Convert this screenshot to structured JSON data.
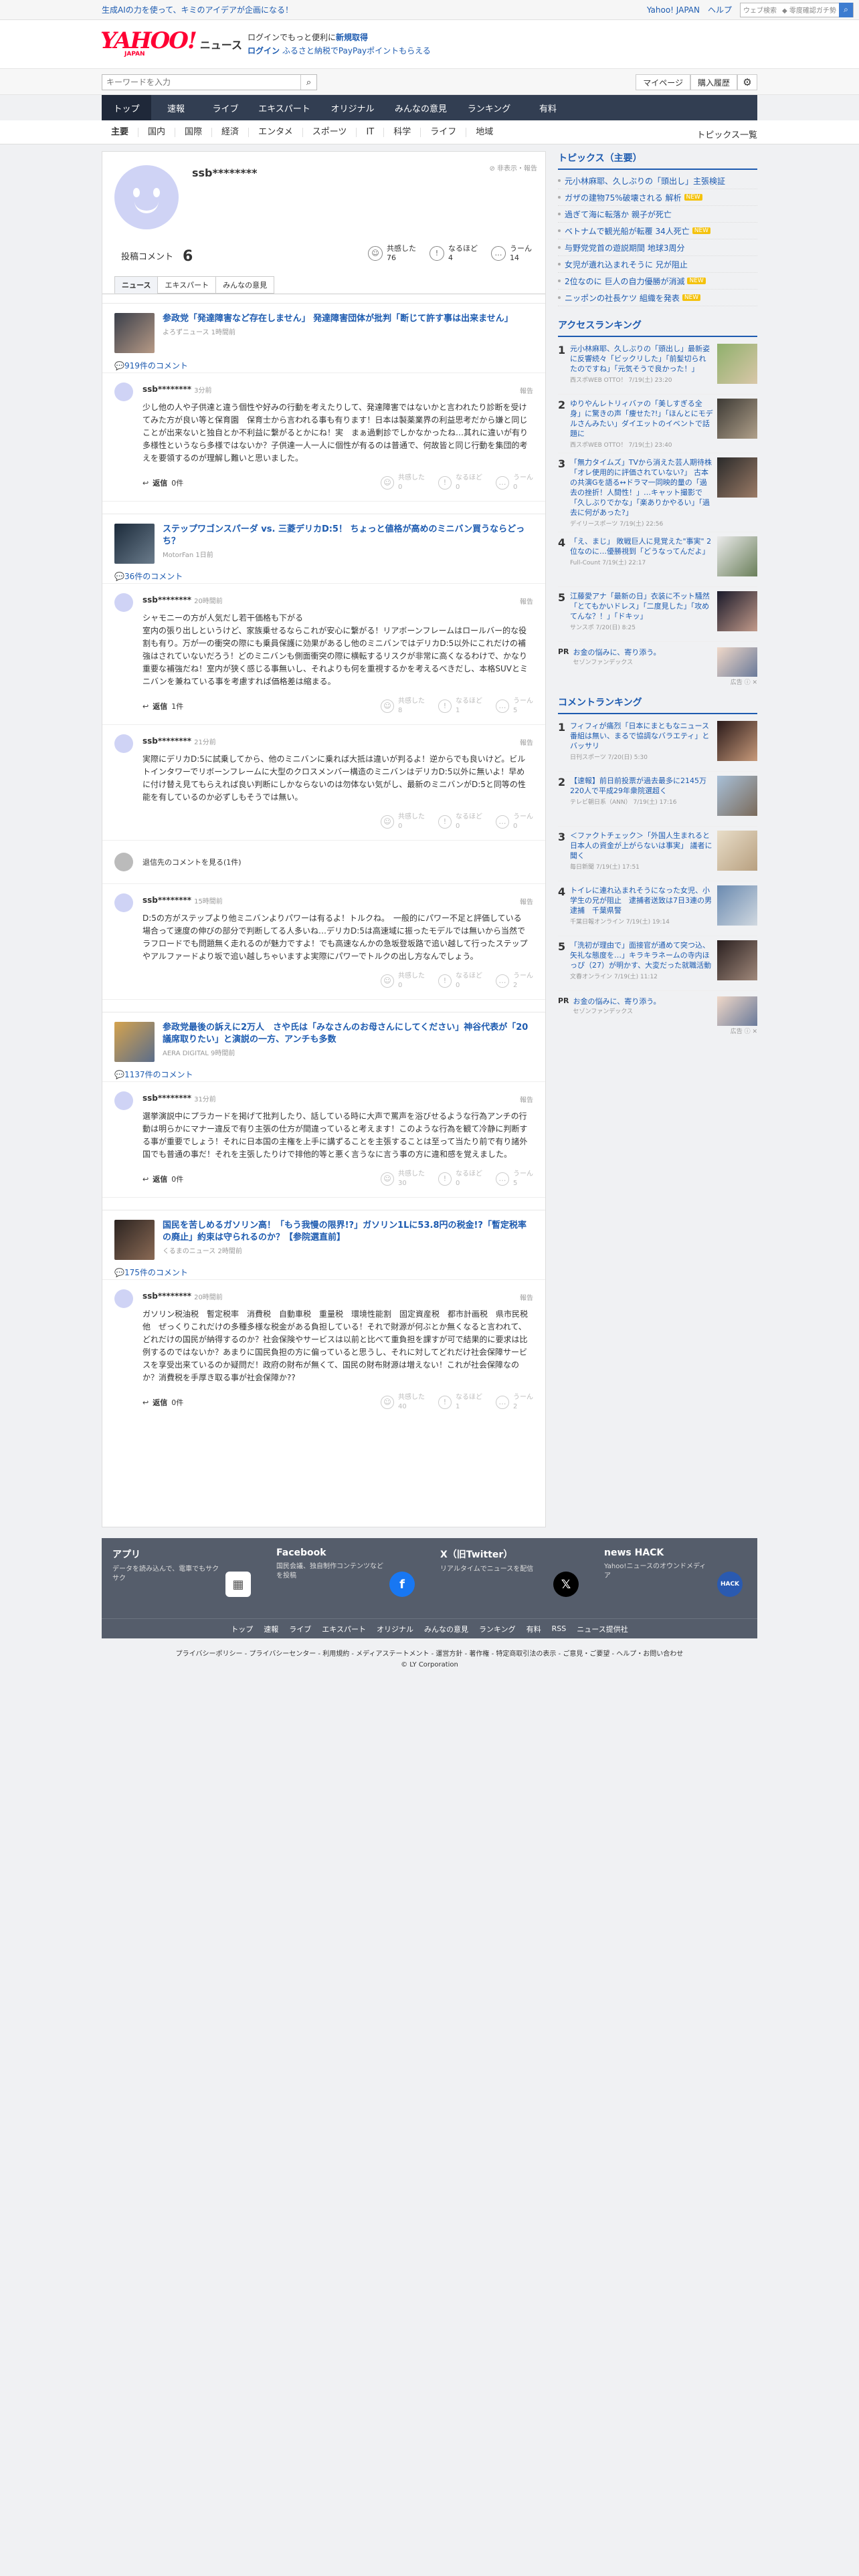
{
  "topbar": {
    "promo": "生成AIの力を使って、キミのアイデアが企画になる！",
    "links": [
      "Yahoo! JAPAN",
      "ヘルプ"
    ],
    "search_placeholder": "ウェブ検索",
    "search_tag": "◆ 零度確認ガチ勢"
  },
  "logo": {
    "main": "YAHOO!",
    "sub": "JAPAN",
    "news": "ニュース"
  },
  "hinfo": {
    "line1_pre": "ログインでもっと便利に",
    "line1_b": "新規取得",
    "login": "ログイン",
    "furusato": "ふるさと納税でPayPayポイントもらえる"
  },
  "search": {
    "placeholder": "キーワードを入力",
    "mypage": "マイページ",
    "history": "購入履歴"
  },
  "gnav": [
    "トップ",
    "速報",
    "ライブ",
    "エキスパート",
    "オリジナル",
    "みんなの意見",
    "ランキング",
    "有料"
  ],
  "snav": [
    "主要",
    "国内",
    "国際",
    "経済",
    "エンタメ",
    "スポーツ",
    "IT",
    "科学",
    "ライフ",
    "地域"
  ],
  "snav_right": "トピックス一覧",
  "profile": {
    "name": "ssb********",
    "report": "非表示・報告",
    "posted_label": "投稿コメント",
    "posted_count": "6",
    "reactions": [
      {
        "label": "共感した",
        "count": "76"
      },
      {
        "label": "なるほど",
        "count": "4"
      },
      {
        "label": "うーん",
        "count": "14"
      }
    ]
  },
  "tabs": [
    "ニュース",
    "エキスパート",
    "みんなの意見"
  ],
  "articles": [
    {
      "title": "参政党「発達障害など存在しません」 発達障害団体が批判「断じて許す事は出来ません」",
      "source": "よろずニュース 1時間前",
      "ccount": "919件のコメント",
      "comments": [
        {
          "user": "ssb********",
          "time": "3分前",
          "report": "報告",
          "text": "少し他の人や子供達と違う個性や好みの行動を考えたりして、発達障害ではないかと言われたり診断を受けてみた方が良い等と保育園　保育士から言われる事も有ります！日本は製薬業界の利益思考だから嫌と同じことが出来ないと独自とか不利益に繋がるとかにね！実　まぁ過剰診でしかなかったね…其れに違いが有り多様性というなら多様ではないか？子供達一人一人に個性が有るのは普通で、何故皆と同じ行動を集団的考えを要領するのが理解し難いと思いました。",
          "reply": "返信",
          "reply_count": "0件",
          "r": [
            "0",
            "0",
            "0"
          ]
        }
      ]
    },
    {
      "title": "ステップワゴンスパーダ vs. 三菱デリカD:5！ ちょっと値格が高めのミニバン買うならどっち？",
      "source": "MotorFan 1日前",
      "ccount": "36件のコメント",
      "comments": [
        {
          "user": "ssb********",
          "time": "20時間前",
          "report": "報告",
          "text": "シャモニーの方が人気だし若干価格も下がる\n室内の張り出しというけど、家族乗せるならこれが安心に繋がる！リアボーンフレームはロールバー的な役割も有り。万が一の衝突の際にも乗員保護に効果があるし他のミニバンではデリカD:5以外にこれだけの補強はされていないだろう！どのミニバンも側面衝突の際に横転するリスクが非常に高くなるわけで、かなり重要な補強だね！室内が狭く感じる事無いし、それよりも何を重視するかを考えるべきだし、本格SUVとミニバンを兼ねている事を考慮すれば価格差は縮まる。",
          "reply": "返信",
          "reply_count": "1件",
          "r": [
            "8",
            "1",
            "5"
          ]
        },
        {
          "user": "ssb********",
          "time": "21分前",
          "report": "報告",
          "text": "実際にデリカD:5に試乗してから、他のミニバンに乗れば大抵は違いが判るよ！逆からでも良いけど。ビルトインタワーでリボーンフレームに大型のクロスメンバー構造のミニバンはデリカD:5以外に無いよ！早めに付け替え見てもらえれば良い判断にしかならないのは勿体ない気がし、最新のミニバンがD:5と同等の性能を有しているのか必ずしもそうでは無い。",
          "reply": "",
          "reply_count": "",
          "r": [
            "0",
            "0",
            "0"
          ]
        }
      ],
      "deleted": "退信先のコメントを見る(1件)",
      "comments2": [
        {
          "user": "ssb********",
          "time": "15時間前",
          "report": "報告",
          "text": "D:5の方がステップより他ミニバンよりパワーは有るよ！トルクね。　一般的にパワー不足と評価している場合って速度の伸びの部分で判断してる人多いね…デリカD:5は高速域に振ったモデルでは無いから当然でラフロードでも問題無く走れるのが魅力ですよ！でも高速なんかの急坂登坂路で追い越して行ったステップやアルファードより坂で追い越しちゃいますよ実際にパワーでトルクの出し方なんでしょう。",
          "r": [
            "0",
            "0",
            "2"
          ]
        }
      ]
    },
    {
      "title": "参政党最後の訴えに2万人　さや氏は「みなさんのお母さんにしてください」神谷代表が「20議席取りたい」と演説の一方、アンチも多数",
      "source": "AERA DIGITAL 9時間前",
      "ccount": "1137件のコメント",
      "comments": [
        {
          "user": "ssb********",
          "time": "31分前",
          "report": "報告",
          "text": "選挙演説中にプラカードを掲げて批判したり、話している時に大声で罵声を浴びせるような行為アンチの行動は明らかにマナー違反で有り主張の仕方が間違っていると考えます！このような行為を観て冷静に判断する事が重要でしょう！それに日本国の主権を上手に講ずることを主張することは至って当たり前で有り諸外国でも普通の事だ！それを主張したりけで排他的等と悪く言うなに言う事の方に違和感を覚えました。",
          "reply": "返信",
          "reply_count": "0件",
          "r": [
            "30",
            "0",
            "5"
          ]
        }
      ]
    },
    {
      "title": "国民を苦しめるガソリン高！「もう我慢の限界!?」ガソリン1Lに53.8円の税金!?「暫定税率の廃止」約束は守られるのか？【参院選直前】",
      "source": "くるまのニュース 2時間前",
      "ccount": "175件のコメント",
      "comments": [
        {
          "user": "ssb********",
          "time": "20時間前",
          "report": "報告",
          "text": "ガソリン税油税　暫定税率　消費税　自動車税　重量税　環境性能割　固定資産税　都市計画税　県市民税　他　ぜっくりこれだけの多種多様な税金がある負担している！それで財源が何ぶとか無くなると言われて、どれだけの国民が納得するのか？社会保険やサービスは以前と比べて重負担を課すが可で結果的に要求は比例するのではないか？あまりに国民負担の方に偏っていると思うし、それに対してどれだけ社会保障サービスを享受出来ているのか疑問だ！政府の財布が無くて、国民の財布財源は増えない！これが社会保障なのか？消費税を手厚き取る事が社会保障か??",
          "reply": "返信",
          "reply_count": "0件",
          "r": [
            "40",
            "1",
            "2"
          ]
        }
      ]
    }
  ],
  "side": {
    "topics_title": "トピックス（主要）",
    "topics": [
      {
        "t": "元小林麻耶、久しぶりの「頭出し」主張検証",
        "n": ""
      },
      {
        "t": "ガザの建物75%破壊される 解析",
        "n": "NEW"
      },
      {
        "t": "過ぎて海に転落か 親子が死亡",
        "n": ""
      },
      {
        "t": "ベトナムで観光船が転覆 34人死亡",
        "n": "NEW"
      },
      {
        "t": "与野党党首の遊説期間 地球3周分",
        "n": ""
      },
      {
        "t": "女児が遺れ込まれそうに 兄が阻止",
        "n": ""
      },
      {
        "t": "2位なのに 巨人の自力優勝が消滅",
        "n": "NEW"
      },
      {
        "t": "ニッポンの社長ケツ 組織を発表",
        "n": "NEW"
      }
    ],
    "access_title": "アクセスランキング",
    "access": [
      {
        "n": "1",
        "t": "元小林麻耶、久しぶりの「頭出し」最新姿に反響続々「ビックリした」「前髪切られたのですね」「元気そうで良かった！」",
        "s": "西スポWEB OTTO！ 7/19(土) 23:20"
      },
      {
        "n": "2",
        "t": "ゆりやんレトリィバァの「美しすぎる全身」に驚きの声「痩せた?!」「ほんとにモデルさんみたい」ダイエットのイベントで話題に",
        "s": "西スポWEB OTTO！ 7/19(土) 23:40"
      },
      {
        "n": "3",
        "t": "「無力タイムズ」TVから消えた芸人期待株「オレ使用的に評価されていない?」 古本の共演Gを語る↔ドラマ一同映的量の「過去の挫折！人間性！」…キャット撮影で「久しぶりでかな」「楽ありかやるい」「過去に何があった?」",
        "s": "デイリースポーツ 7/19(土) 22:56"
      },
      {
        "n": "4",
        "t": "「え、まじ」 敗戦巨人に見覚えた\"事実\" 2位なのに…優勝視到「どうなってんだよ」",
        "s": "Full-Count 7/19(土) 22:17"
      },
      {
        "n": "5",
        "t": "江藤愛アナ「最新の日」衣装に不ット騒然「とてもかいドレス」「二度見した」「攻めてんな？！」「ドキッ」",
        "s": "サンスポ 7/20(日) 8:25"
      }
    ],
    "pr1": {
      "label": "PR",
      "t": "お金の悩みに、寄り添う。",
      "s": "セゾンファンデックス",
      "ad": "広告"
    },
    "comment_title": "コメントランキング",
    "cranks": [
      {
        "n": "1",
        "t": "フィフィが痛烈「日本にまともなニュース番組は無い、まるで協調なバラエティ」とバッサリ",
        "s": "日刊スポーツ 7/20(日) 5:30"
      },
      {
        "n": "2",
        "t": "【速報】前日前投票が過去最多に2145万220人で平成29年衆院選超く",
        "s": "テレビ朝日系（ANN） 7/19(土) 17:16"
      },
      {
        "n": "3",
        "t": "＜ファクトチェック＞「外国人生まれると日本人の資金が上がらないは事実」 議者に聞く",
        "s": "毎日新聞 7/19(土) 17:51"
      },
      {
        "n": "4",
        "t": "トイレに連れ込まれそうになった女児、小学生の兄が阻止　逮捕者送致は7日3連の男逮捕　千葉県警",
        "s": "千葉日報オンライン 7/19(土) 19:14"
      },
      {
        "n": "5",
        "t": "「洗初が理由で」面接官が通めて突つ込、矢礼な態度を…」キラキラネームの寺内ほっぴ（27）が明かす、大変だった就職活動",
        "s": "文春オンライン 7/19(土) 11:12"
      }
    ],
    "pr2": {
      "label": "PR",
      "t": "お金の悩みに、寄り添う。",
      "s": "セゾンファンデックス",
      "ad": "広告"
    }
  },
  "footer": {
    "cols": [
      {
        "h": "アプリ",
        "p": "データを読み込んで、電車でもサクサク"
      },
      {
        "h": "Facebook",
        "p": "国民会議、独自制作コンテンツなどを投稿"
      },
      {
        "h": "X（旧Twitter）",
        "p": "リアルタイムでニュースを配信"
      },
      {
        "h": "news HACK",
        "p": "Yahoo!ニュースのオウンドメディア"
      }
    ],
    "links": [
      "トップ",
      "速報",
      "ライブ",
      "エキスパート",
      "オリジナル",
      "みんなの意見",
      "ランキング",
      "有料",
      "RSS",
      "ニュース提供社"
    ],
    "legal1": "プライバシーポリシー - プライバシーセンター - 利用規約 - メディアステートメント - 運営方針 - 著作権 - 特定商取引法の表示 - ご意見・ご要望 - ヘルプ・お問い合わせ",
    "copyright": "© LY Corporation"
  }
}
